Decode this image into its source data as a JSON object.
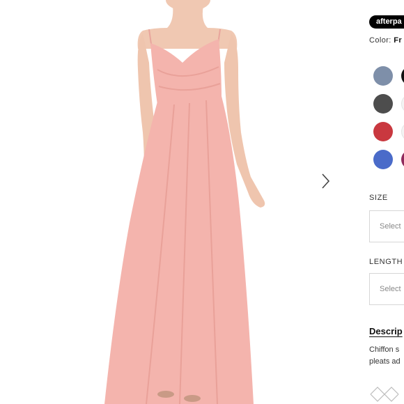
{
  "gallery": {
    "image_icon": "product-photo-pink-chiffon-gown",
    "next_icon": "chevron-right-icon"
  },
  "afterpay": {
    "label": "afterpa"
  },
  "color": {
    "label": "Color:",
    "value": "Fr"
  },
  "swatches": [
    {
      "color": "#7e8fa9"
    },
    {
      "color": "#111111"
    },
    {
      "color": "#4d4d4d"
    },
    {
      "color": "#f4f4f4"
    },
    {
      "color": "#c9383f"
    },
    {
      "color": "#f4f4f4"
    },
    {
      "color": "#4a6bc9"
    },
    {
      "color": "#8f2a5c"
    }
  ],
  "size": {
    "label": "SIZE",
    "placeholder": "Select"
  },
  "length": {
    "label": "LENGTH",
    "placeholder": "Select"
  },
  "description": {
    "heading": "Descrip",
    "line1": "Chiffon s",
    "line2": "pleats ad"
  },
  "icons": {
    "fabric": "fabric-weave-icon"
  },
  "colors": {
    "dress": "#f4b4ad",
    "dress_shade": "#e9a199",
    "skin": "#f0c8b2"
  }
}
